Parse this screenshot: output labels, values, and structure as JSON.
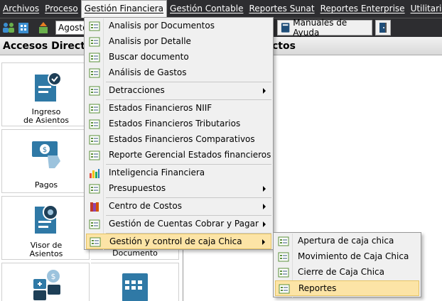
{
  "menubar": {
    "items": [
      {
        "label": "Archivos",
        "active": false
      },
      {
        "label": "Proceso",
        "active": false
      },
      {
        "label": "Gestión Financiera",
        "active": true
      },
      {
        "label": "Gestión Contable",
        "active": false
      },
      {
        "label": "Reportes Sunat",
        "active": false
      },
      {
        "label": "Reportes Enterprise",
        "active": false
      },
      {
        "label": "Utilitarios",
        "active": false
      },
      {
        "label": "?",
        "active": false
      }
    ]
  },
  "toolbar": {
    "period_value": "Agosto",
    "manuals_label": "Manuales de Ayuda"
  },
  "left_panel": {
    "title": "Accesos Directos",
    "tiles": [
      {
        "label_line1": "Ingreso",
        "label_line2": "de Asientos",
        "icon": "document-check-icon"
      },
      {
        "label_line1": "Pagos",
        "label_line2": "",
        "icon": "payment-icon"
      },
      {
        "label_line1": "Visor de",
        "label_line2": "Asientos",
        "icon": "document-view-icon"
      },
      {
        "label_line1": "Documento",
        "label_line2": "",
        "icon": "document-icon"
      },
      {
        "label_line1": "",
        "label_line2": "",
        "icon": "calculator-icon"
      },
      {
        "label_line1": "",
        "label_line2": "",
        "icon": "calendar-icon"
      }
    ]
  },
  "right_panel": {
    "title": "ctos"
  },
  "dropdown": {
    "items": [
      {
        "label": "Analisis por Documentos",
        "has_submenu": false
      },
      {
        "label": "Analisis por Detalle",
        "has_submenu": false
      },
      {
        "label": "Buscar documento",
        "has_submenu": false
      },
      {
        "label": "Análisis de Gastos",
        "has_submenu": false
      },
      {
        "label": "Detracciones",
        "has_submenu": true
      },
      {
        "label": "Estados Financieros NIIF",
        "has_submenu": false
      },
      {
        "label": "Estados Financieros Tributarios",
        "has_submenu": false
      },
      {
        "label": "Estados Financieros Comparativos",
        "has_submenu": false
      },
      {
        "label": "Reporte Gerencial Estados financieros",
        "has_submenu": false
      },
      {
        "label": "Inteligencia Financiera",
        "has_submenu": false
      },
      {
        "label": "Presupuestos",
        "has_submenu": true
      },
      {
        "label": "Centro de Costos",
        "has_submenu": true
      },
      {
        "label": "Gestión de Cuentas Cobrar y Pagar",
        "has_submenu": true
      },
      {
        "label": "Gestión y control de caja Chica",
        "has_submenu": true
      }
    ]
  },
  "submenu": {
    "items": [
      {
        "label": "Apertura de caja chica"
      },
      {
        "label": "Movimiento de Caja Chica"
      },
      {
        "label": "Cierre de Caja Chica"
      },
      {
        "label": "Reportes"
      }
    ]
  },
  "colors": {
    "menubar_bg": "#2d2d30",
    "highlight_bg": "#fce4a6",
    "highlight_border": "#e5c365",
    "icon_blue": "#2f79a6"
  }
}
